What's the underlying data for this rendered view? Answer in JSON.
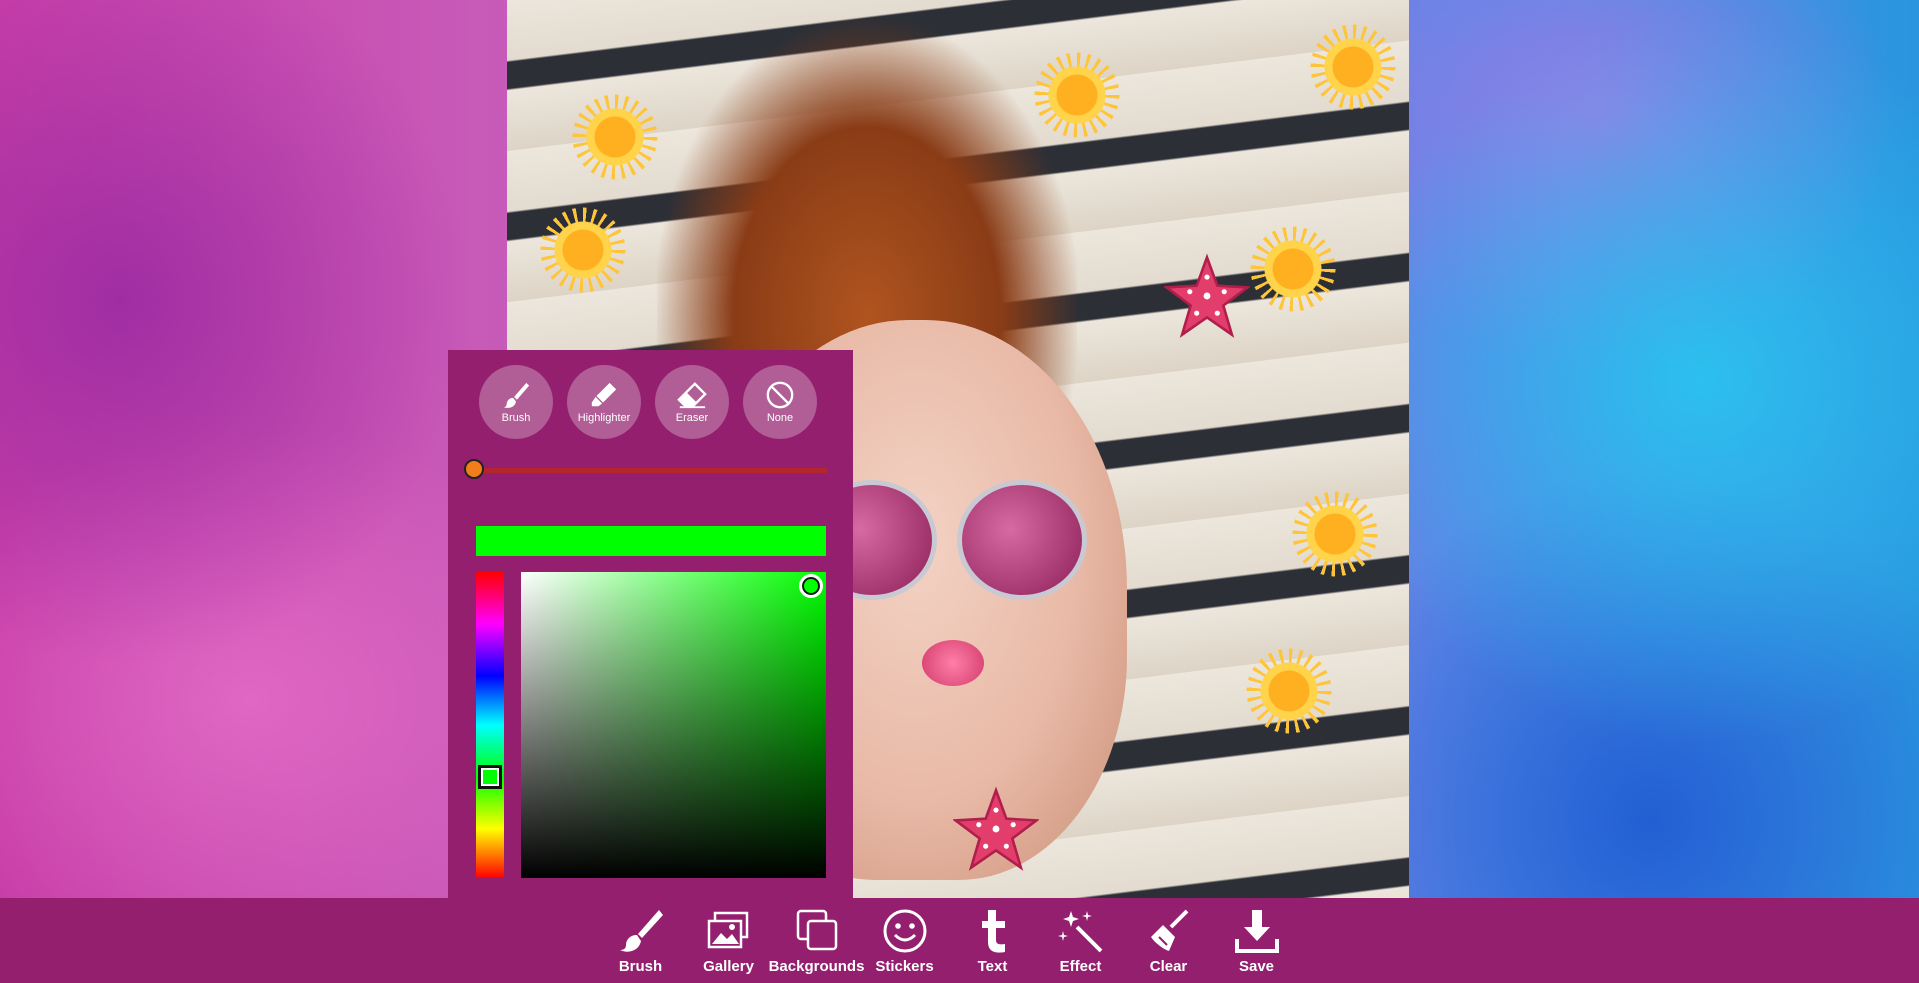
{
  "app": {
    "colors": {
      "accent": "#931f6e",
      "brush_size_track": "#b5252c",
      "brush_size_knob": "#f17e1a"
    }
  },
  "drawing_panel": {
    "tools": [
      {
        "label": "Brush",
        "icon": "brush-icon"
      },
      {
        "label": "Highlighter",
        "icon": "highlighter-icon"
      },
      {
        "label": "Eraser",
        "icon": "eraser-icon"
      },
      {
        "label": "None",
        "icon": "none-icon"
      }
    ],
    "brush_size_fraction": 0,
    "selected_color": "#00ff00",
    "hue_color": "#00ff00"
  },
  "toolbar": {
    "items": [
      {
        "label": "Brush",
        "icon": "brush-icon"
      },
      {
        "label": "Gallery",
        "icon": "gallery-icon"
      },
      {
        "label": "Backgrounds",
        "icon": "backgrounds-icon"
      },
      {
        "label": "Stickers",
        "icon": "stickers-icon"
      },
      {
        "label": "Text",
        "icon": "text-icon"
      },
      {
        "label": "Effect",
        "icon": "effect-icon"
      },
      {
        "label": "Clear",
        "icon": "clear-icon"
      },
      {
        "label": "Save",
        "icon": "save-icon"
      }
    ]
  }
}
